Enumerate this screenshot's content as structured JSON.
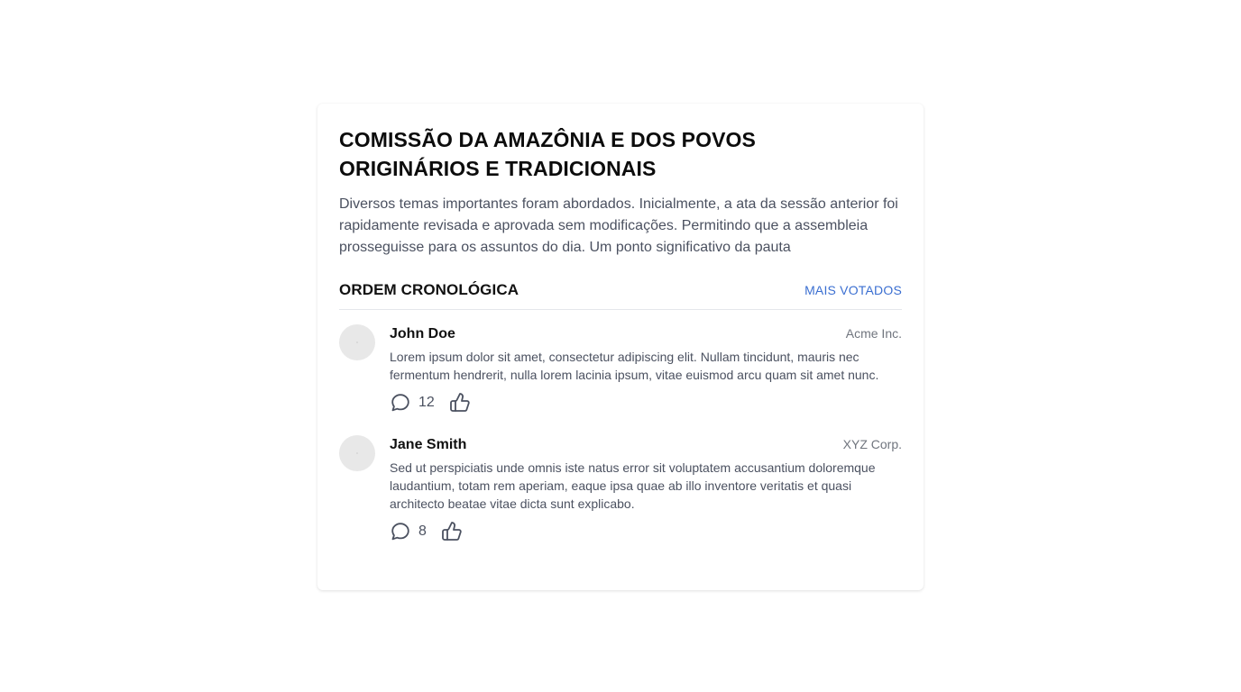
{
  "post": {
    "title": "COMISSÃO DA AMAZÔNIA E DOS POVOS ORIGINÁRIOS E TRADICIONAIS",
    "summary": "Diversos temas importantes foram abordados. Inicialmente, a ata da sessão anterior foi rapidamente revisada e aprovada sem modificações. Permitindo que a assembleia prosseguisse para os assuntos do dia. Um ponto significativo da pauta"
  },
  "sort": {
    "active_label": "ORDEM CRONOLÓGICA",
    "alternate_label": "MAIS VOTADOS"
  },
  "comments": [
    {
      "author": "John Doe",
      "org": "Acme Inc.",
      "text": "Lorem ipsum dolor sit amet, consectetur adipiscing elit. Nullam tincidunt, mauris nec fermentum hendrerit, nulla lorem lacinia ipsum, vitae euismod arcu quam sit amet nunc.",
      "reply_count": "12"
    },
    {
      "author": "Jane Smith",
      "org": "XYZ Corp.",
      "text": "Sed ut perspiciatis unde omnis iste natus error sit voluptatem accusantium doloremque laudantium, totam rem aperiam, eaque ipsa quae ab illo inventore veritatis et quasi architecto beatae vitae dicta sunt explicabo.",
      "reply_count": "8"
    }
  ],
  "icons": {
    "reply": "speech-bubble-icon",
    "like": "thumbs-up-icon"
  },
  "colors": {
    "link": "#3b6fd1",
    "body_text": "#4b5160",
    "muted": "#70757e"
  }
}
